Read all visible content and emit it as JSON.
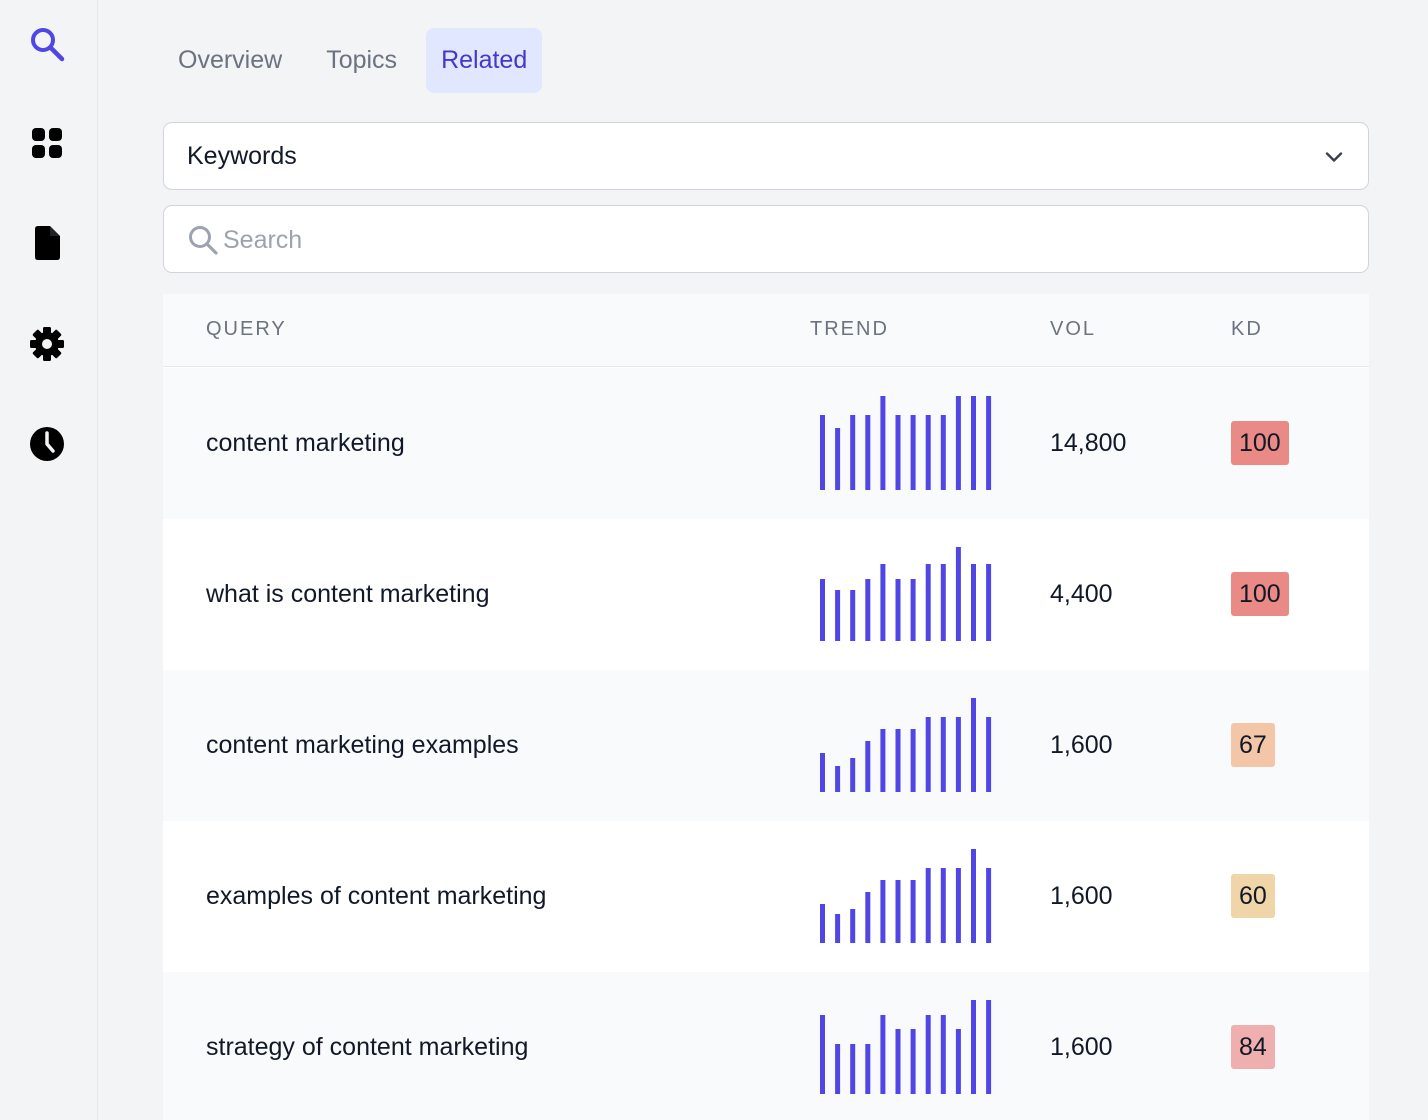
{
  "sidebar": {
    "items": [
      {
        "icon": "search-icon",
        "active": true
      },
      {
        "icon": "grid-icon"
      },
      {
        "icon": "document-icon"
      },
      {
        "icon": "gear-icon"
      },
      {
        "icon": "clock-icon"
      }
    ]
  },
  "tabs": [
    {
      "label": "Overview",
      "active": false
    },
    {
      "label": "Topics",
      "active": false
    },
    {
      "label": "Related",
      "active": true
    }
  ],
  "keyword_select": {
    "value": "Keywords"
  },
  "search": {
    "placeholder": "Search",
    "value": ""
  },
  "table": {
    "columns": {
      "query": "QUERY",
      "trend": "TREND",
      "vol": "VOL",
      "kd": "KD"
    },
    "rows": [
      {
        "query": "content marketing",
        "trend": [
          0.8,
          0.66,
          0.8,
          0.8,
          1.0,
          0.8,
          0.8,
          0.8,
          0.8,
          1.0,
          1.0,
          1.0
        ],
        "vol": "14,800",
        "kd": "100",
        "kd_color": "#ea8a86"
      },
      {
        "query": "what is content marketing",
        "trend": [
          0.66,
          0.54,
          0.54,
          0.66,
          0.82,
          0.66,
          0.66,
          0.82,
          0.82,
          1.0,
          0.82,
          0.82
        ],
        "vol": "4,400",
        "kd": "100",
        "kd_color": "#ea8a86"
      },
      {
        "query": "content marketing examples",
        "trend": [
          0.41,
          0.28,
          0.36,
          0.54,
          0.67,
          0.67,
          0.67,
          0.8,
          0.8,
          0.8,
          1.0,
          0.8
        ],
        "vol": "1,600",
        "kd": "67",
        "kd_color": "#f2c6a7"
      },
      {
        "query": "examples of content marketing",
        "trend": [
          0.41,
          0.31,
          0.36,
          0.54,
          0.67,
          0.67,
          0.67,
          0.8,
          0.8,
          0.8,
          1.0,
          0.8
        ],
        "vol": "1,600",
        "kd": "60",
        "kd_color": "#efd5a8"
      },
      {
        "query": "strategy of content marketing",
        "trend": [
          0.84,
          0.53,
          0.53,
          0.53,
          0.84,
          0.69,
          0.69,
          0.84,
          0.84,
          0.69,
          1.0,
          1.0
        ],
        "vol": "1,600",
        "kd": "84",
        "kd_color": "#eeafae"
      }
    ]
  },
  "colors": {
    "accent": "#4f46e5",
    "tab_active_bg": "#e0e7ff",
    "tab_active_text": "#4338ca"
  }
}
